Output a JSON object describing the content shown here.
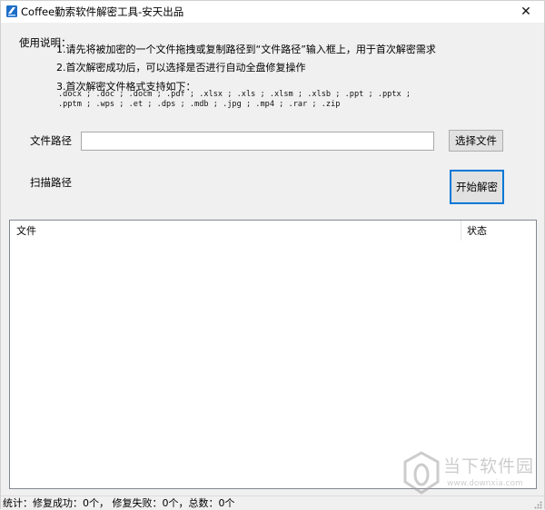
{
  "titlebar": {
    "title": "Coffee勤索软件解密工具-安天出品",
    "close_glyph": "✕",
    "icon": "app-icon"
  },
  "instructions": {
    "heading": "使用说明：",
    "items": [
      "1.请先将被加密的一个文件拖拽或复制路径到“文件路径”输入框上，用于首次解密需求",
      "2.首次解密成功后，可以选择是否进行自动全盘修复操作",
      "3.首次解密文件格式支持如下："
    ],
    "formats_line1": ".docx ; .doc ; .docm ; .pdf ; .xlsx ; .xls ; .xlsm ; .xlsb ; .ppt ; .pptx ;",
    "formats_line2": ".pptm ; .wps ; .et ; .dps ; .mdb ; .jpg ; .mp4 ; .rar ; .zip"
  },
  "form": {
    "file_path_label": "文件路径",
    "file_path_value": "",
    "browse_label": "选择文件",
    "scan_path_label": "扫描路径",
    "start_label": "开始解密"
  },
  "list": {
    "columns": [
      "文件",
      "状态"
    ],
    "rows": []
  },
  "statusbar": {
    "text": "统计：修复成功：0个， 修复失败：0个，总数：0个"
  },
  "watermark": {
    "name": "当下软件园",
    "url": "www.downxia.com"
  },
  "colors": {
    "window_bg": "#f0f0f0",
    "focus_border": "#0078d7",
    "app_icon_blue": "#1e6ec8"
  }
}
